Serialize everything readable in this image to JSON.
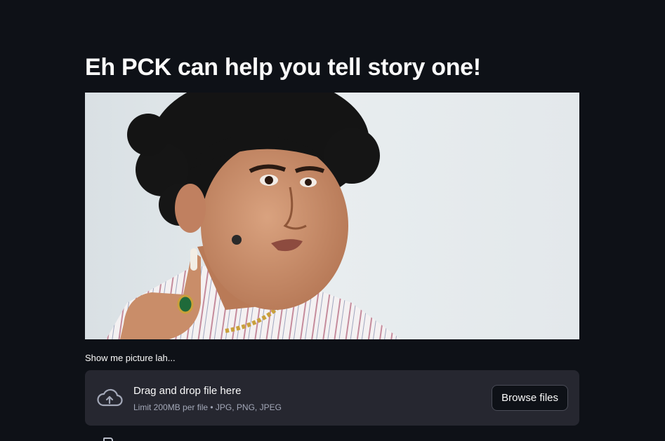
{
  "header": {
    "title": "Eh PCK can help you tell story one!"
  },
  "hero_image": {
    "icon": "portrait-photo"
  },
  "uploader": {
    "label": "Show me picture lah...",
    "drop_title": "Drag and drop file here",
    "limit_text": "Limit 200MB per file • JPG, PNG, JPEG",
    "browse_label": "Browse files",
    "upload_icon": "cloud-upload-icon"
  },
  "colors": {
    "background": "#0e1117",
    "dropzone": "#262730",
    "text": "#fafafa",
    "muted_text": "#a3a8b8"
  }
}
